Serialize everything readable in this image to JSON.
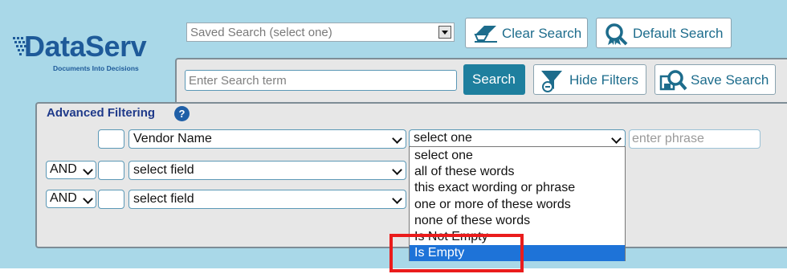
{
  "brand": {
    "name": "DataServ",
    "tagline": "Documents Into Decisions"
  },
  "saved_search": {
    "value": "Saved Search (select one)"
  },
  "toolbar": {
    "clear_label": "Clear Search",
    "default_label": "Default Search",
    "search_label": "Search",
    "hide_filters_label": "Hide Filters",
    "save_label": "Save Search"
  },
  "search": {
    "placeholder": "Enter Search term"
  },
  "advanced": {
    "title": "Advanced Filtering",
    "help": "?",
    "rows": [
      {
        "connector": "",
        "field": "Vendor Name",
        "operator": "select one",
        "phrase_placeholder": "enter phrase"
      },
      {
        "connector": "AND",
        "field": "select field"
      },
      {
        "connector": "AND",
        "field": "select field"
      }
    ]
  },
  "operator_options": [
    "select one",
    "all of these words",
    "this exact wording or phrase",
    "one or more of these words",
    "none of these words",
    "Is Not Empty",
    "Is Empty"
  ],
  "selected_option_index": 6,
  "colors": {
    "accent": "#1e7f9e",
    "highlight": "#1e73d8",
    "callout": "#ea1c1c",
    "background": "#a9d8e8"
  }
}
